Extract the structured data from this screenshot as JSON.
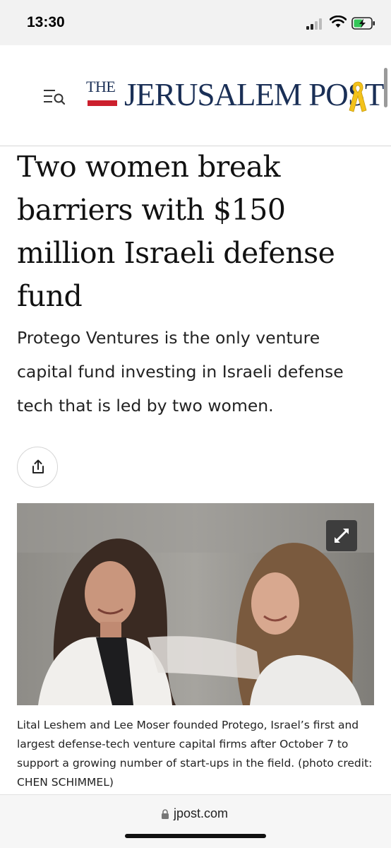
{
  "status_bar": {
    "time": "13:30"
  },
  "header": {
    "menu_icon": "menu-search-icon",
    "logo": {
      "the": "THE",
      "name": "JERUSALEM POST"
    },
    "ribbon_icon": "yellow-ribbon-icon"
  },
  "article": {
    "headline": "Two women break barriers with $150 million Israeli defense fund",
    "subheadline": "Protego Ventures is the only venture capital fund investing in Israeli defense tech that is led by two women.",
    "share_icon": "share-icon",
    "photo": {
      "expand_icon": "expand-arrows-icon"
    },
    "caption": "Lital Leshem and Lee Moser founded Protego, Israel’s first and largest defense-tech venture capital firms after October 7 to support a growing number of start-ups in the field. (photo credit: CHEN SCHIMMEL)"
  },
  "browser_bar": {
    "domain": "jpost.com",
    "lock_icon": "lock-icon"
  },
  "colors": {
    "brand_navy": "#1a2f56",
    "brand_red": "#cc1f2d",
    "ribbon_yellow": "#f3c21a"
  }
}
